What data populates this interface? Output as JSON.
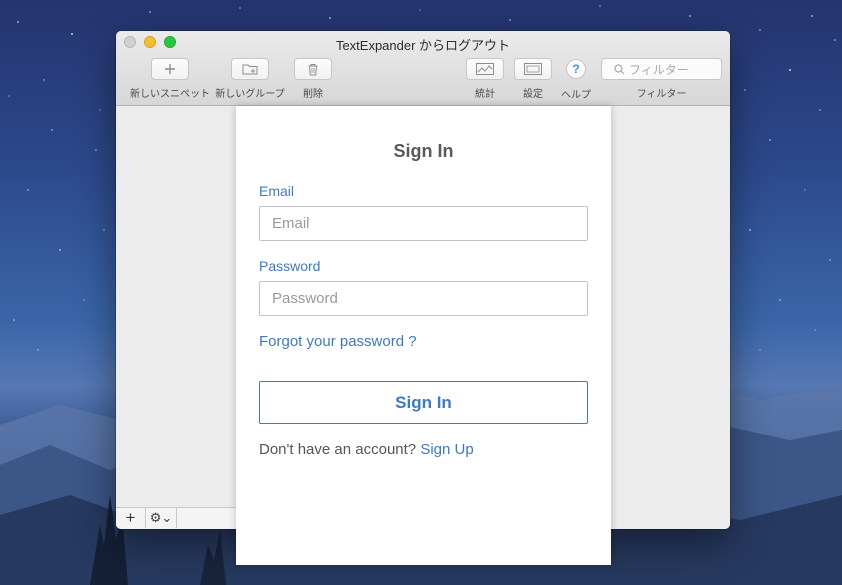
{
  "window": {
    "title": "TextExpander からログアウト"
  },
  "toolbar": {
    "new_snippet": "新しいスニペット",
    "new_group": "新しいグループ",
    "delete": "削除",
    "stats": "統計",
    "settings": "設定",
    "help": "ヘルプ",
    "help_glyph": "?",
    "filter_label": "フィルター",
    "filter_placeholder": "フィルター"
  },
  "bottom_bar": {
    "add_glyph": "+",
    "gear_glyph": "⚙⌄"
  },
  "signin": {
    "title": "Sign In",
    "email_label": "Email",
    "email_placeholder": "Email",
    "email_value": "",
    "password_label": "Password",
    "password_placeholder": "Password",
    "password_value": "",
    "forgot_link": "Forgot your password ?",
    "submit_label": "Sign In",
    "no_account_text": "Don't have an account? ",
    "signup_link": "Sign Up"
  },
  "colors": {
    "accent": "#3f79c0",
    "title_text": "#5a5a5a",
    "traffic_min": "#f6be2e",
    "traffic_max": "#27c840"
  },
  "icons": [
    "plus-icon",
    "folder-add-icon",
    "trash-icon",
    "chart-icon",
    "settings-panel-icon",
    "help-icon",
    "search-icon",
    "gear-icon"
  ]
}
